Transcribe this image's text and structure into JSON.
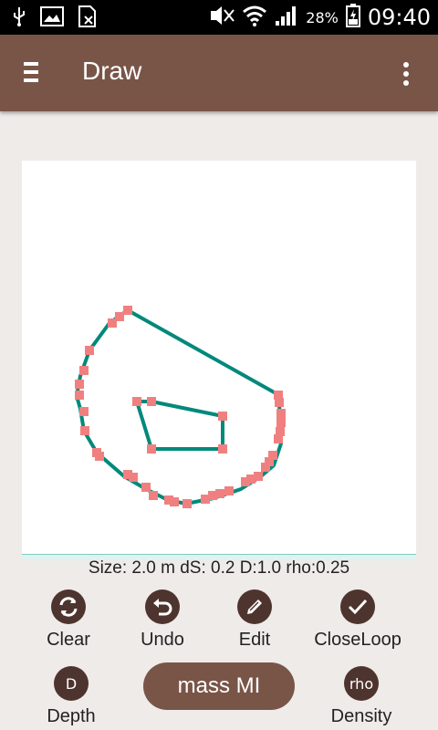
{
  "status_bar": {
    "icons": [
      "usb-icon",
      "image-icon",
      "sim-icon",
      "mute-icon",
      "wifi-icon",
      "signal-icon",
      "battery-icon"
    ],
    "battery": "28%",
    "time": "09:40"
  },
  "toolbar": {
    "title": "Draw",
    "background": "#795548"
  },
  "drawing": {
    "line_color": "#00897b",
    "point_color": "#f08080"
  },
  "info": {
    "text": "Size: 2.0 m  dS: 0.2  D:1.0  rho:0.25"
  },
  "controls": {
    "clear": "Clear",
    "undo": "Undo",
    "edit": "Edit",
    "closeloop": "CloseLoop",
    "depth": "Depth",
    "depth_glyph": "D",
    "density": "Density",
    "density_glyph": "rho",
    "mass_button": "mass MI"
  }
}
